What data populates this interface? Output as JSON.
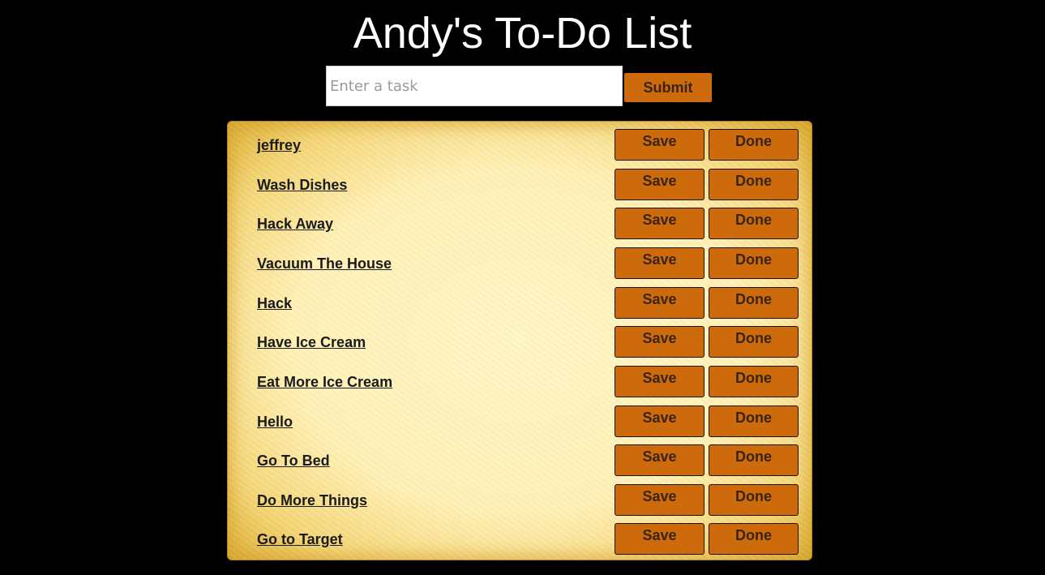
{
  "header": {
    "title": "Andy's To-Do List"
  },
  "form": {
    "placeholder": "Enter a task",
    "value": "",
    "submit_label": "Submit"
  },
  "tasks": [
    {
      "label": "jeffrey",
      "save_label": "Save",
      "done_label": "Done"
    },
    {
      "label": "Wash Dishes",
      "save_label": "Save",
      "done_label": "Done"
    },
    {
      "label": "Hack Away",
      "save_label": "Save",
      "done_label": "Done"
    },
    {
      "label": "Vacuum The House",
      "save_label": "Save",
      "done_label": "Done"
    },
    {
      "label": "Hack",
      "save_label": "Save",
      "done_label": "Done"
    },
    {
      "label": "Have Ice Cream",
      "save_label": "Save",
      "done_label": "Done"
    },
    {
      "label": "Eat More Ice Cream",
      "save_label": "Save",
      "done_label": "Done"
    },
    {
      "label": "Hello",
      "save_label": "Save",
      "done_label": "Done"
    },
    {
      "label": "Go To Bed",
      "save_label": "Save",
      "done_label": "Done"
    },
    {
      "label": "Do More Things",
      "save_label": "Save",
      "done_label": "Done"
    },
    {
      "label": "Go to Target",
      "save_label": "Save",
      "done_label": "Done"
    }
  ],
  "colors": {
    "background": "#000000",
    "button": "#cc6a0c",
    "button_text": "#3a2410",
    "panel": "#fff1b8",
    "panel_border": "#d9ab2c"
  }
}
